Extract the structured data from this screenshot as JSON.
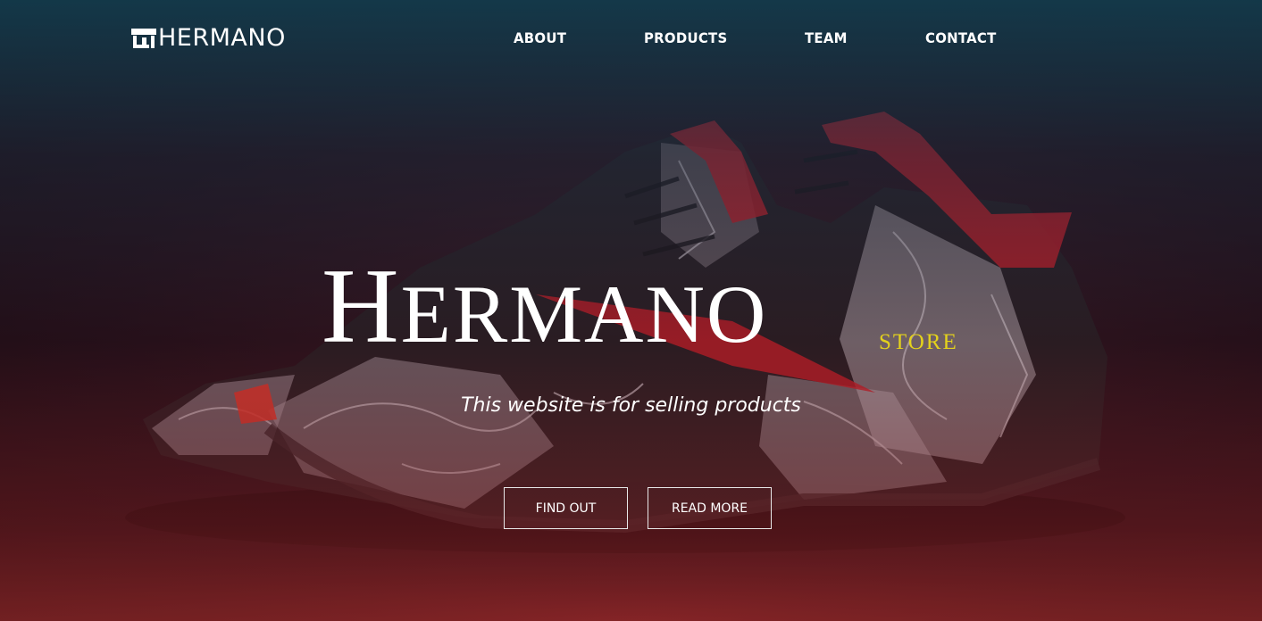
{
  "nav": {
    "logo_text": "HERMANO",
    "links": [
      {
        "label": "ABOUT"
      },
      {
        "label": "PRODUCTS"
      },
      {
        "label": "TEAM"
      },
      {
        "label": "CONTACT"
      }
    ]
  },
  "hero": {
    "title_initial": "H",
    "title_rest": "ERMANO",
    "subtitle_badge": "STORE",
    "tagline": "This website is for selling products",
    "buttons": [
      {
        "label": "FIND OUT"
      },
      {
        "label": "READ MORE"
      }
    ]
  },
  "colors": {
    "accent_yellow": "#e4d21c",
    "shoe_red": "#e0202a"
  },
  "icons": {
    "logo": "shop-icon"
  }
}
